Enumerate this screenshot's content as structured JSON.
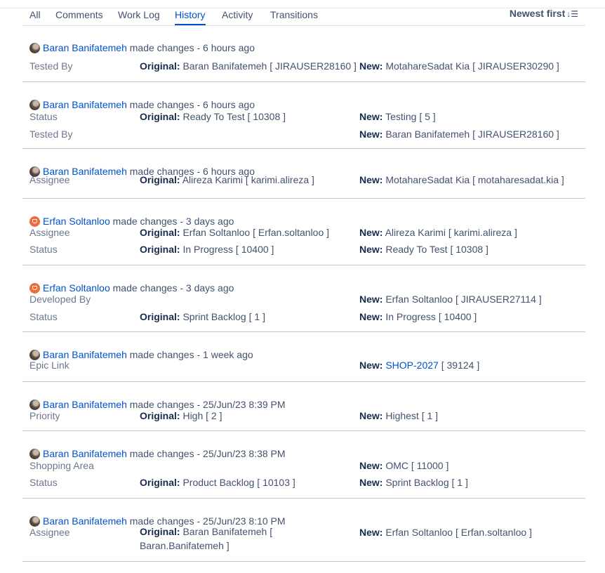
{
  "tabs": [
    {
      "label": "All"
    },
    {
      "label": "Comments"
    },
    {
      "label": "Work Log"
    },
    {
      "label": "History"
    },
    {
      "label": "Activity"
    },
    {
      "label": "Transitions"
    }
  ],
  "active_tab": "History",
  "sort": {
    "label": "Newest first",
    "icon": "sort-descending-icon"
  },
  "labels": {
    "original": "Original:",
    "new": "New:"
  },
  "colors": {
    "link": "#0052cc",
    "active_tab_underline": "#0052cc"
  },
  "entries": [
    {
      "user": "Baran Banifatemeh",
      "avatar": "photo",
      "action": "made changes - 6 hours ago",
      "changes": [
        {
          "field": "Tested By",
          "original": "Baran Banifatemeh [ JIRAUSER28160 ]",
          "new": "MotahareSadat Kia [ JIRAUSER30290 ]"
        }
      ]
    },
    {
      "user": "Baran Banifatemeh",
      "avatar": "photo",
      "action": "made changes - 6 hours ago",
      "changes": [
        {
          "field": "Status",
          "original": "Ready To Test [ 10308 ]",
          "new": "Testing [ 5 ]"
        },
        {
          "field": "Tested By",
          "original": "",
          "new": "Baran Banifatemeh [ JIRAUSER28160 ]"
        }
      ]
    },
    {
      "user": "Baran Banifatemeh",
      "avatar": "photo",
      "action": "made changes - 6 hours ago",
      "changes": [
        {
          "field": "Assignee",
          "original": "Alireza Karimi [ karimi.alireza ]",
          "new": "MotahareSadat Kia [ motaharesadat.kia ]"
        }
      ]
    },
    {
      "user": "Erfan Soltanloo",
      "avatar": "logo",
      "action": "made changes - 3 days ago",
      "changes": [
        {
          "field": "Assignee",
          "original": "Erfan Soltanloo [ Erfan.soltanloo ]",
          "new": "Alireza Karimi [ karimi.alireza ]"
        },
        {
          "field": "Status",
          "original": "In Progress [ 10400 ]",
          "new": "Ready To Test [ 10308 ]"
        }
      ]
    },
    {
      "user": "Erfan Soltanloo",
      "avatar": "logo",
      "action": "made changes - 3 days ago",
      "changes": [
        {
          "field": "Developed By",
          "original": "",
          "new": "Erfan Soltanloo [ JIRAUSER27114 ]"
        },
        {
          "field": "Status",
          "original": "Sprint Backlog [ 1 ]",
          "new": "In Progress [ 10400 ]"
        }
      ]
    },
    {
      "user": "Baran Banifatemeh",
      "avatar": "photo",
      "action": "made changes - 1 week ago",
      "changes": [
        {
          "field": "Epic Link",
          "original": "",
          "new_link": "SHOP-2027",
          "new_suffix": " [ 39124 ]"
        }
      ]
    },
    {
      "user": "Baran Banifatemeh",
      "avatar": "photo",
      "action": "made changes - 25/Jun/23 8:39 PM",
      "changes": [
        {
          "field": "Priority",
          "original": "High [ 2 ]",
          "new": "Highest [ 1 ]"
        }
      ]
    },
    {
      "user": "Baran Banifatemeh",
      "avatar": "photo",
      "action": "made changes - 25/Jun/23 8:38 PM",
      "changes": [
        {
          "field": "Shopping Area",
          "original": "",
          "new": "OMC [ 11000 ]"
        },
        {
          "field": "Status",
          "original": "Product Backlog [ 10103 ]",
          "new": "Sprint Backlog [ 1 ]"
        }
      ]
    },
    {
      "user": "Baran Banifatemeh",
      "avatar": "photo",
      "action": "made changes - 25/Jun/23 8:10 PM",
      "changes": [
        {
          "field": "Assignee",
          "original": "Baran Banifatemeh [ Baran.Banifatemeh ]",
          "new": "Erfan Soltanloo [ Erfan.soltanloo ]"
        }
      ]
    }
  ]
}
